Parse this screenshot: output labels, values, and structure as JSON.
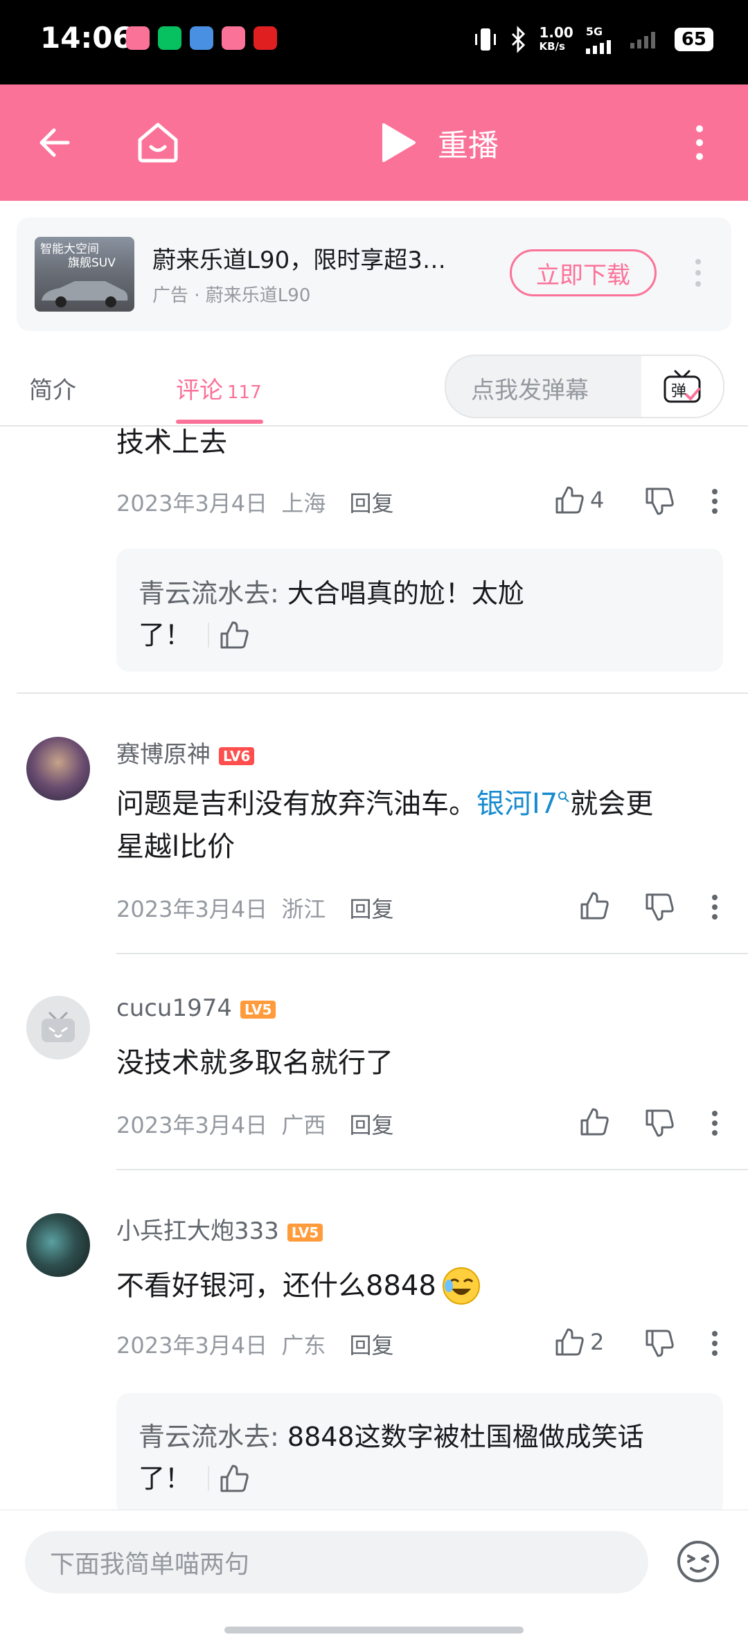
{
  "status_bar": {
    "time": "14:06",
    "network_speed": "1.00",
    "network_unit": "KB/s",
    "network_type": "5G",
    "battery": "65"
  },
  "header": {
    "replay_label": "重播"
  },
  "ad": {
    "thumb_text_line1": "智能大空间",
    "thumb_text_line2": "旗舰SUV",
    "title": "蔚来乐道L90，限时享超3…",
    "subtitle": "广告 · 蔚来乐道L90",
    "button": "立即下载"
  },
  "tabs": {
    "intro": "简介",
    "comments": "评论",
    "comments_count": "117",
    "danmaku_placeholder": "点我发弹幕",
    "danmaku_badge": "弹"
  },
  "comments": [
    {
      "text": "技术上去",
      "date": "2023年3月4日",
      "location": "上海",
      "reply": "回复",
      "likes": "4",
      "sub_reply": {
        "name": "青云流水去",
        "text_line1": "大合唱真的尬！太尬",
        "text_line2": "了！"
      }
    },
    {
      "username": "赛博原神",
      "level": "LV6",
      "text_before": "问题是吉利没有放弃汽油车。",
      "link": "银河I7",
      "text_after_line1": "就会更",
      "text_line2": "星越l比价",
      "date": "2023年3月4日",
      "location": "浙江",
      "reply": "回复"
    },
    {
      "username": "cucu1974",
      "level": "LV5",
      "text": "没技术就多取名就行了",
      "date": "2023年3月4日",
      "location": "广西",
      "reply": "回复"
    },
    {
      "username": "小兵扛大炮333",
      "level": "LV5",
      "text": "不看好银河，还什么8848",
      "date": "2023年3月4日",
      "location": "广东",
      "reply": "回复",
      "likes": "2",
      "sub_reply": {
        "name": "青云流水去",
        "text_line1": "8848这数字被杜国楹做成笑话",
        "text_line2": "了！"
      }
    }
  ],
  "bottom": {
    "input_placeholder": "下面我简单喵两句"
  },
  "colors": {
    "brand_pink": "#fb7299",
    "lv6": "#ff4e4e",
    "lv5": "#ff9b3b",
    "link": "#178bcf"
  }
}
